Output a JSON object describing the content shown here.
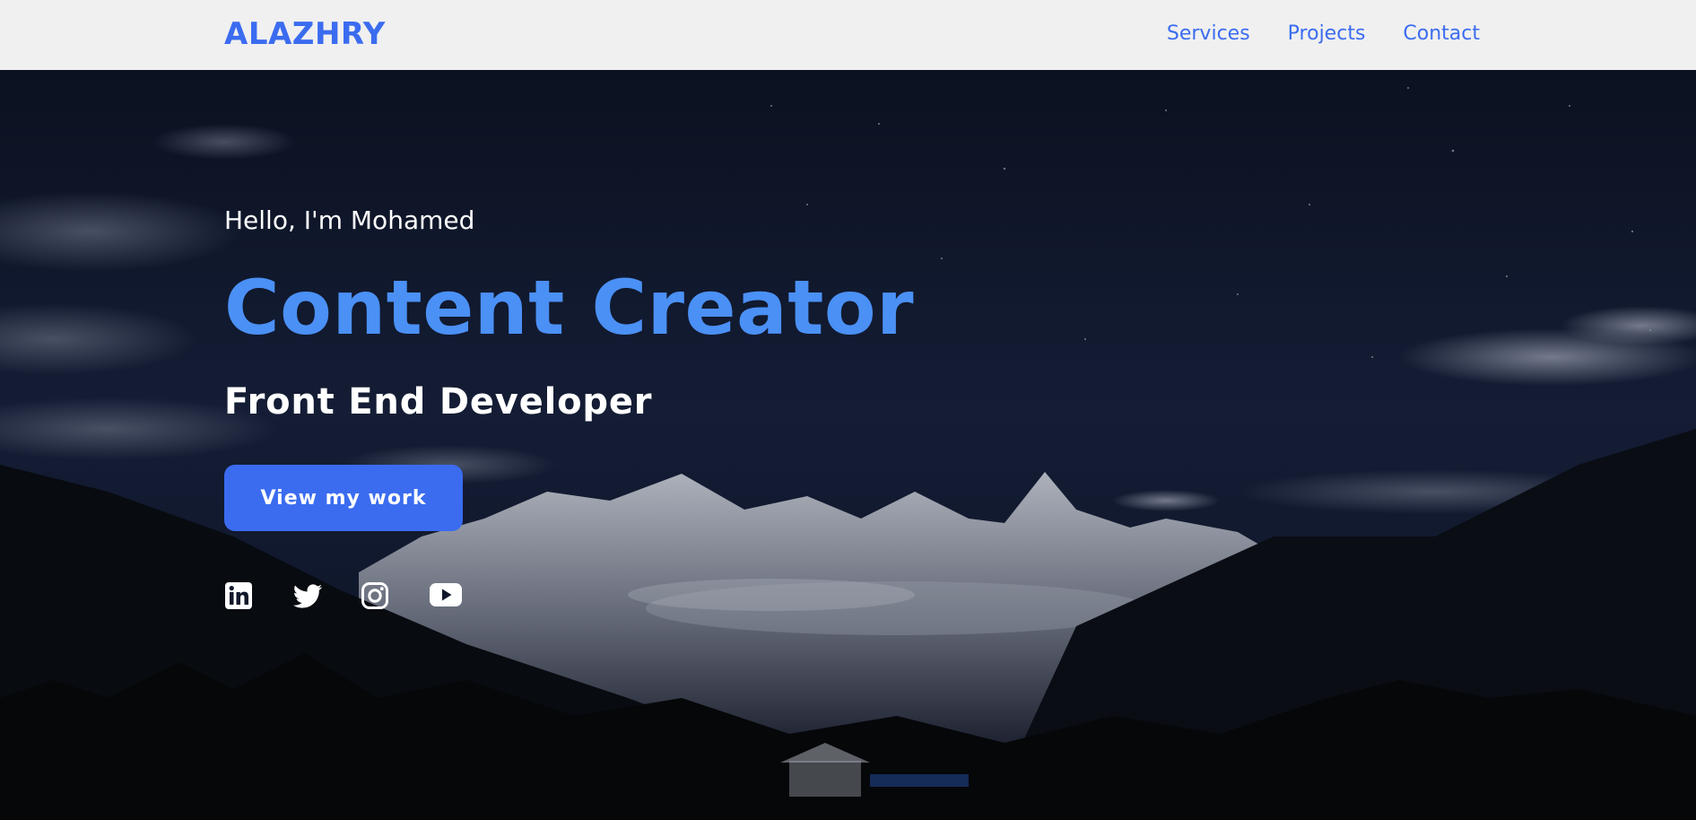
{
  "navbar": {
    "brand": "ALAZHRY",
    "links": [
      {
        "label": "Services"
      },
      {
        "label": "Projects"
      },
      {
        "label": "Contact"
      }
    ]
  },
  "hero": {
    "greeting": "Hello, I'm Mohamed",
    "headline": "Content Creator",
    "subheadline": "Front End Developer",
    "cta_label": "View my work",
    "background": "night-mountain-landscape",
    "socials": [
      {
        "icon": "linkedin-icon"
      },
      {
        "icon": "twitter-icon"
      },
      {
        "icon": "instagram-icon"
      },
      {
        "icon": "youtube-icon"
      }
    ]
  },
  "colors": {
    "accent": "#3b6cf0",
    "headline": "#4b90f5",
    "nav_background": "#f0f0f0",
    "text_light": "#ffffff"
  }
}
